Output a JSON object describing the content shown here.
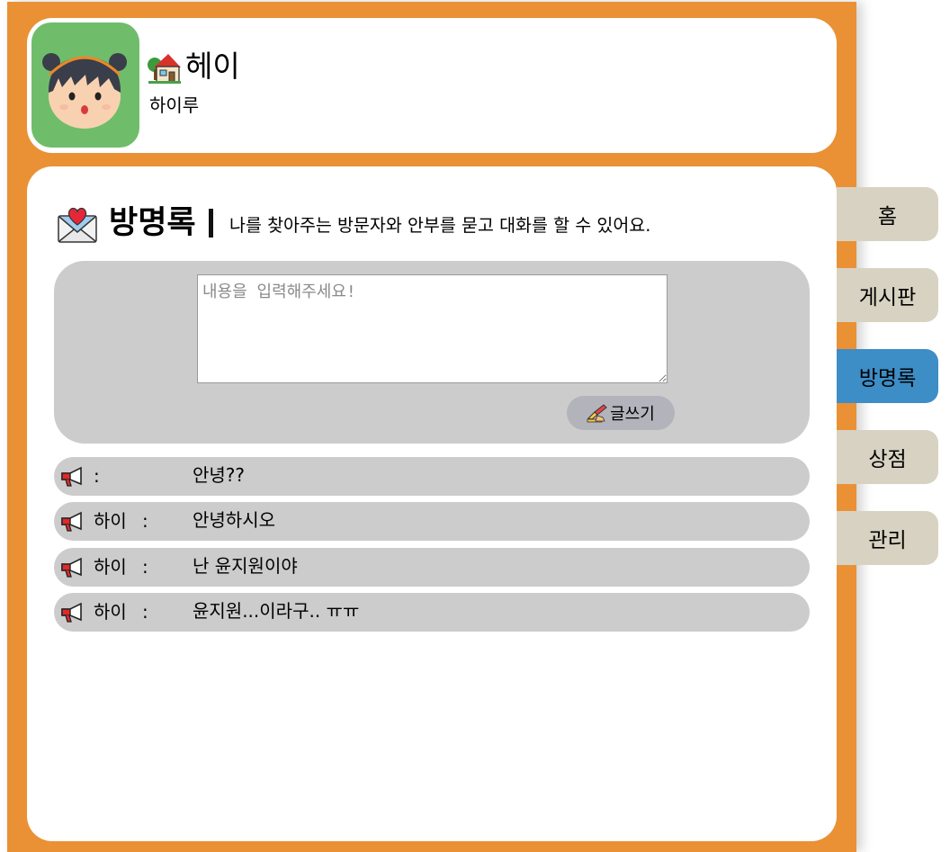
{
  "profile": {
    "name": "헤이",
    "status": "하이루"
  },
  "guestbook": {
    "title": "방명록",
    "separator": "|",
    "description": "나를 찾아주는 방문자와 안부를 묻고 대화를 할 수 있어요.",
    "input_placeholder": "내용을 입력해주세요!",
    "input_value": "",
    "write_label": "글쓰기",
    "entries": [
      {
        "author": "",
        "colon": ":",
        "message": "안녕??"
      },
      {
        "author": "하이",
        "colon": ":",
        "message": "안녕하시오"
      },
      {
        "author": "하이",
        "colon": ":",
        "message": "난 윤지원이야"
      },
      {
        "author": "하이",
        "colon": ":",
        "message": "윤지원...이라구.. ㅠㅠ"
      }
    ]
  },
  "tabs": [
    {
      "label": "홈",
      "active": false
    },
    {
      "label": "게시판",
      "active": false
    },
    {
      "label": "방명록",
      "active": true
    },
    {
      "label": "상점",
      "active": false
    },
    {
      "label": "관리",
      "active": false
    }
  ],
  "colors": {
    "frame": "#ea9135",
    "card": "#ffffff",
    "panel": "#cccccc",
    "tab": "#d8d2c2",
    "tab_active": "#3d8dc6",
    "avatar_bg": "#6fbd6a"
  },
  "icons": {
    "avatar": "girl-avatar-icon",
    "home": "house-icon",
    "guestbook": "love-letter-icon",
    "write": "writing-hand-icon",
    "entry": "megaphone-icon"
  }
}
